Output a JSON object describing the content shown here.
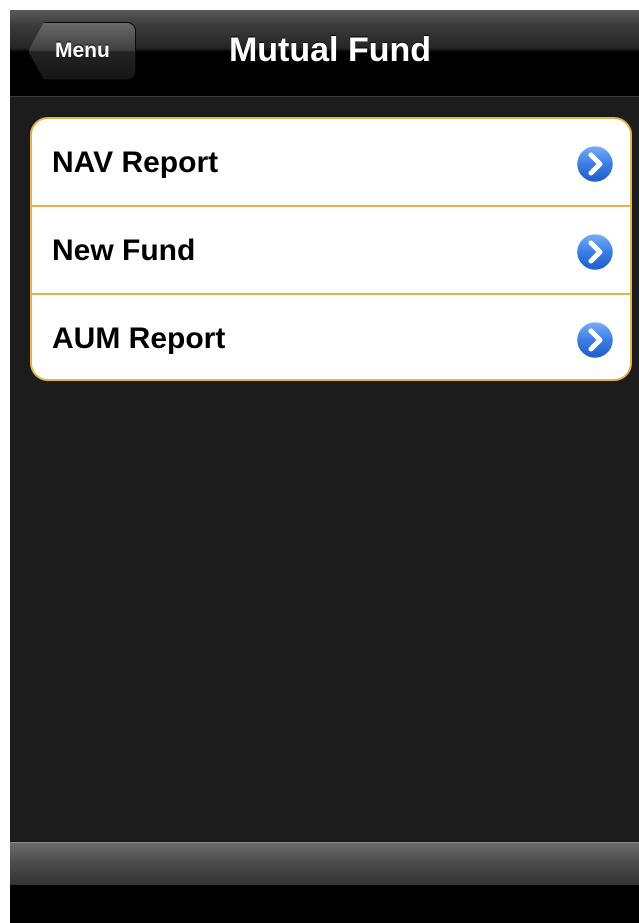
{
  "navbar": {
    "back_label": "Menu",
    "title": "Mutual Fund"
  },
  "menu": {
    "items": [
      {
        "label": "NAV Report",
        "icon": "chevron-right-circle-icon"
      },
      {
        "label": "New Fund",
        "icon": "chevron-right-circle-icon"
      },
      {
        "label": "AUM Report",
        "icon": "chevron-right-circle-icon"
      }
    ]
  },
  "colors": {
    "accent_border": "#e6b24a",
    "disclosure_blue": "#2f6fd8",
    "background": "#1c1c1c"
  }
}
